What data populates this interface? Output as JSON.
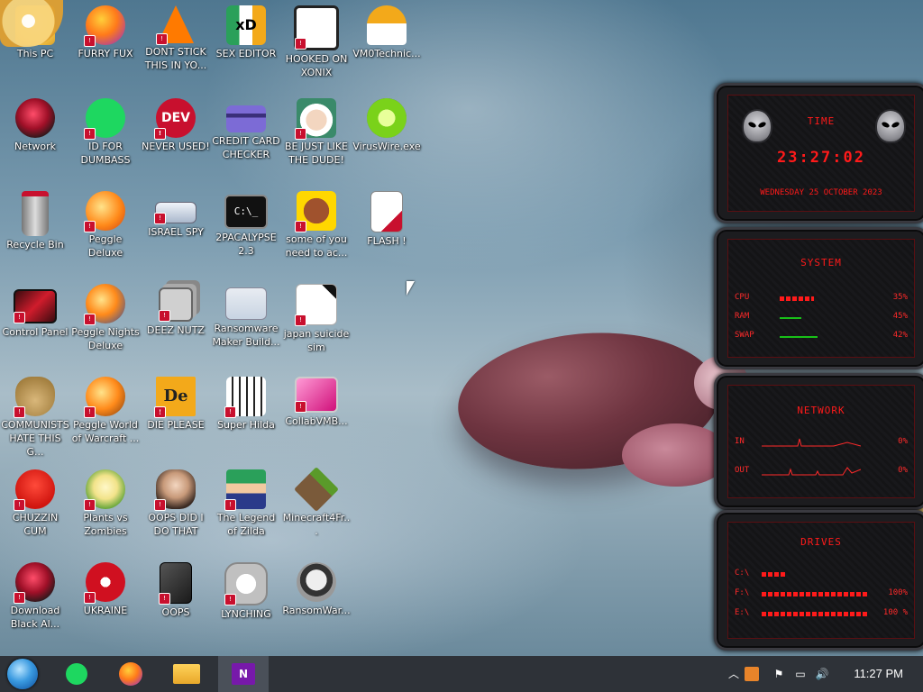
{
  "desktop": {
    "icons": [
      {
        "label": "This PC"
      },
      {
        "label": "FURRY FUX"
      },
      {
        "label": "DONT STICK THIS IN YO..."
      },
      {
        "label": "SEX EDITOR"
      },
      {
        "label": "HOOKED ON XONIX"
      },
      {
        "label": "VM0Technic..."
      },
      {
        "label": "Network"
      },
      {
        "label": "ID FOR DUMBASS"
      },
      {
        "label": "NEVER USED!"
      },
      {
        "label": "CREDIT CARD CHECKER"
      },
      {
        "label": "BE JUST LIKE THE DUDE!"
      },
      {
        "label": "VirusWire.exe"
      },
      {
        "label": "Recycle Bin"
      },
      {
        "label": "Peggle Deluxe"
      },
      {
        "label": "ISRAEL SPY"
      },
      {
        "label": "2PACALYPSE 2.3"
      },
      {
        "label": "some of you need to ac..."
      },
      {
        "label": "FLASH !"
      },
      {
        "label": "Control Panel"
      },
      {
        "label": "Peggle Nights Deluxe"
      },
      {
        "label": "DEEZ NUTZ"
      },
      {
        "label": "Ransomware Maker Build..."
      },
      {
        "label": "japan suicide sim"
      },
      {
        "label": "COMMUNISTS HATE THIS G..."
      },
      {
        "label": "Peggle World of Warcraft ..."
      },
      {
        "label": "DIE PLEASE"
      },
      {
        "label": "Super Hilda"
      },
      {
        "label": "CollabVMB..."
      },
      {
        "label": "CHUZZIN CUM"
      },
      {
        "label": "Plants vs Zombies"
      },
      {
        "label": "OOPS DID I DO THAT"
      },
      {
        "label": "The Legend of Zilda"
      },
      {
        "label": "Minecraft4Fr..."
      },
      {
        "label": "Download Black Al..."
      },
      {
        "label": "UKRAINE"
      },
      {
        "label": "OOPS"
      },
      {
        "label": "LYNCHING"
      },
      {
        "label": "RansomWar..."
      }
    ]
  },
  "gadget": {
    "time": {
      "title": "TIME",
      "clock": "23:27:02",
      "date": "WEDNESDAY 25 OCTOBER 2023"
    },
    "system": {
      "title": "SYSTEM",
      "rows": [
        {
          "label": "CPU",
          "value": "35%",
          "level": 0.35
        },
        {
          "label": "RAM",
          "value": "45%",
          "level": 0.45
        },
        {
          "label": "SWAP",
          "value": "42%",
          "level": 0.42
        }
      ]
    },
    "network": {
      "title": "NETWORK",
      "rows": [
        {
          "label": "IN",
          "value": "0%"
        },
        {
          "label": "OUT",
          "value": "0%"
        }
      ]
    },
    "drives": {
      "title": "DRIVES",
      "rows": [
        {
          "label": "C:\\",
          "value": "",
          "level": 0.3
        },
        {
          "label": "F:\\",
          "value": "100%",
          "level": 1.0
        },
        {
          "label": "E:\\",
          "value": "100 %",
          "level": 1.0
        }
      ]
    }
  },
  "taskbar": {
    "start_icon": "start-orb-icon",
    "pinned": [
      {
        "name": "spotify-like-icon"
      },
      {
        "name": "firefox-icon"
      },
      {
        "name": "file-explorer-icon"
      },
      {
        "name": "onenote-icon",
        "active": true
      }
    ],
    "clock": "11:27 PM"
  },
  "colors": {
    "accent_red": "#ff1a1a",
    "taskbar": "#2e3238"
  }
}
